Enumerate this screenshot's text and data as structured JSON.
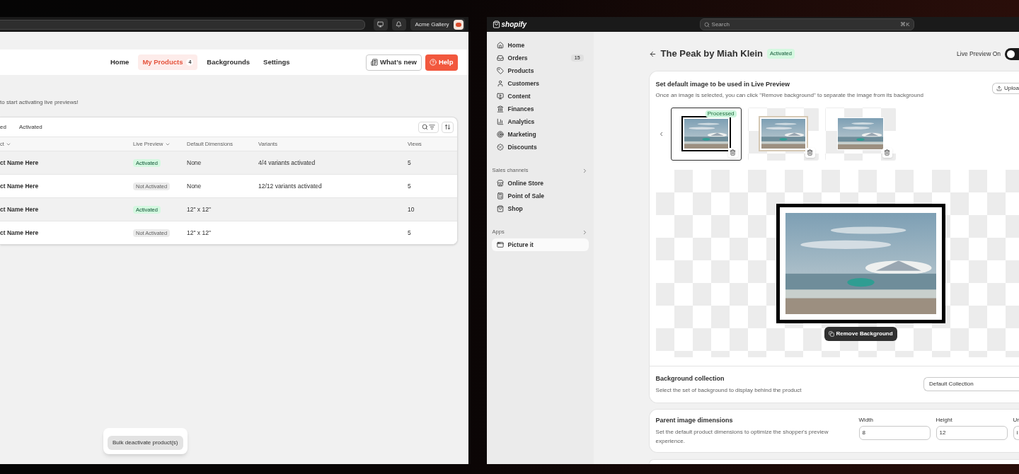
{
  "left_app": {
    "top_bar": {
      "store_name": "Acme Gallery"
    },
    "nav": [
      {
        "label": "Home",
        "selected": false
      },
      {
        "label": "My Products",
        "selected": true,
        "badge": "4"
      },
      {
        "label": "Backgrounds",
        "selected": false
      },
      {
        "label": "Settings",
        "selected": false
      }
    ],
    "whats_new": "What’s new",
    "help": "Help",
    "intro_text": "to start activating live previews!",
    "filter_tabs": [
      {
        "label": "ed",
        "selected": false
      },
      {
        "label": "Activated",
        "selected": false
      }
    ],
    "table": {
      "columns": [
        {
          "label": "ct",
          "sortable": true
        },
        {
          "label": "Live Preview",
          "sortable": true
        },
        {
          "label": "Default Dimensions",
          "sortable": false
        },
        {
          "label": "Variants",
          "sortable": false
        },
        {
          "label": "Views",
          "sortable": false
        }
      ],
      "rows": [
        {
          "product": "ct Name Here",
          "status": "Activated",
          "activated": true,
          "dimensions": "None",
          "variants": "4/4 variants activated",
          "views": "5",
          "selected": true
        },
        {
          "product": "ct Name Here",
          "status": "Not Activated",
          "activated": false,
          "dimensions": "None",
          "variants": "12/12 variants activated",
          "views": "5",
          "selected": false
        },
        {
          "product": "ct Name Here",
          "status": "Activated",
          "activated": true,
          "dimensions": "12\" x 12\"",
          "views": "10",
          "selected": true
        },
        {
          "product": "ct Name Here",
          "status": "Not Activated",
          "activated": false,
          "dimensions": "12\" x 12\"",
          "views": "5",
          "selected": false
        }
      ]
    },
    "bulk_action": "Bulk deactivate product(s)"
  },
  "right_app": {
    "logo": "shopify",
    "search": {
      "placeholder": "Search",
      "shortcut": "⌘K"
    },
    "sidebar": {
      "items": [
        {
          "label": "Home",
          "selected": false
        },
        {
          "label": "Orders",
          "selected": false,
          "badge": "15"
        },
        {
          "label": "Products",
          "selected": false
        },
        {
          "label": "Customers",
          "selected": false
        },
        {
          "label": "Content",
          "selected": false
        },
        {
          "label": "Finances",
          "selected": false
        },
        {
          "label": "Analytics",
          "selected": false
        },
        {
          "label": "Marketing",
          "selected": false
        },
        {
          "label": "Discounts",
          "selected": false
        }
      ],
      "sections": [
        {
          "title": "Sales channels",
          "items": [
            {
              "label": "Online Store",
              "selected": false
            },
            {
              "label": "Point of Sale",
              "selected": false
            },
            {
              "label": "Shop",
              "selected": false
            }
          ]
        },
        {
          "title": "Apps",
          "items": [
            {
              "label": "Picture it",
              "selected": true
            }
          ]
        }
      ]
    },
    "page_title": "The Peak by Miah Klein",
    "status": "Activated",
    "live_preview": {
      "label": "Live Preview On",
      "on": true
    },
    "image_card": {
      "heading": "Set default image to be used in Live Preview",
      "description": "Once an image is selected, you can click \"Remove background\" to separate the image from its background",
      "upload": "Uploa",
      "thumbnails": [
        {
          "kind": "black-frame",
          "selected": true,
          "badge": "Processed"
        },
        {
          "kind": "light-frame",
          "selected": false
        },
        {
          "kind": "unframed",
          "selected": false
        }
      ],
      "remove_background": "Remove Background"
    },
    "background_collection": {
      "title": "Background collection",
      "description": "Select the set of background to display behind the product",
      "value": "Default Collection"
    },
    "dimensions": {
      "title": "Parent image dimensions",
      "description": "Set the default product dimensions to optimize the shopper's preview experience.",
      "fields": [
        {
          "label": "Width",
          "value": "8"
        },
        {
          "label": "Height",
          "value": "12"
        },
        {
          "label": "Ur",
          "value": "i"
        }
      ]
    }
  }
}
